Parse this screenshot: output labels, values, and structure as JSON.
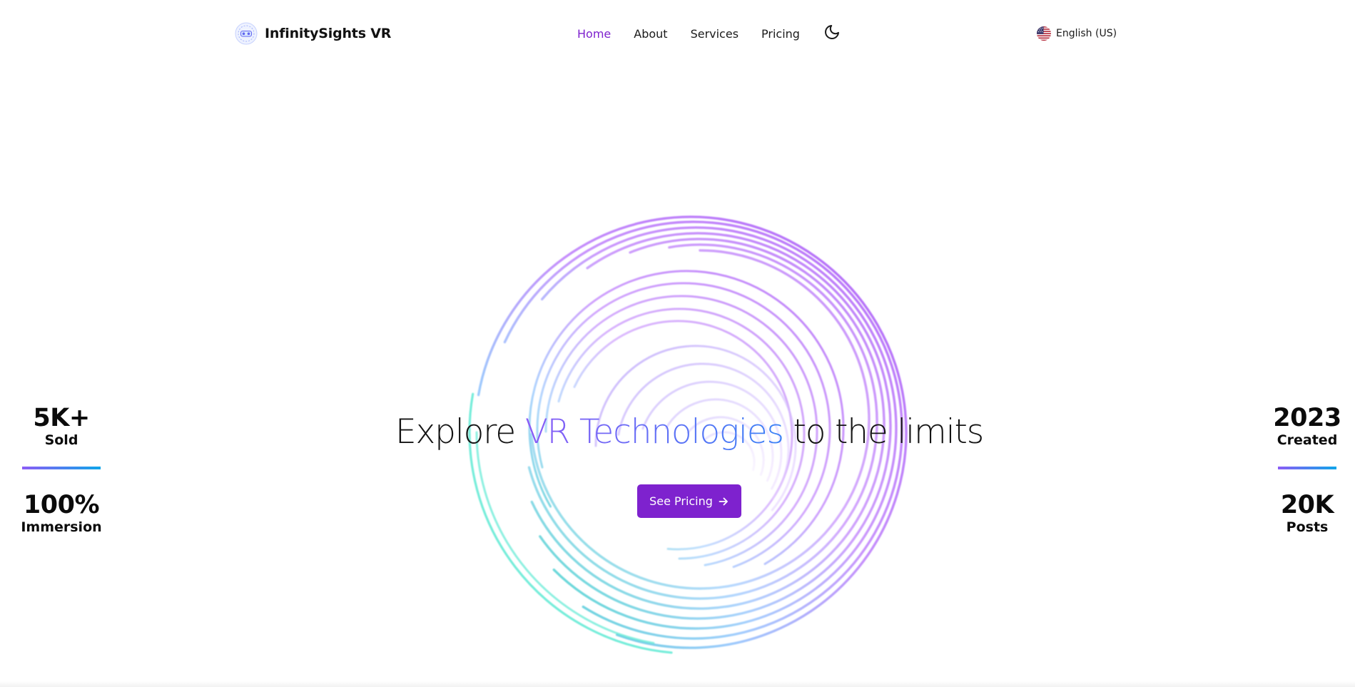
{
  "brand": {
    "name": "InfinitySights VR",
    "logo_icon": "vr-headset-logo-icon"
  },
  "nav": {
    "items": [
      {
        "label": "Home",
        "active": true
      },
      {
        "label": "About",
        "active": false
      },
      {
        "label": "Services",
        "active": false
      },
      {
        "label": "Pricing",
        "active": false
      }
    ],
    "theme_toggle_icon": "moon-icon",
    "active_color": "#7e22ce"
  },
  "language": {
    "label": "English (US)",
    "flag_icon": "us-flag-icon"
  },
  "hero": {
    "title_before": "Explore",
    "title_highlight": "VR Technologies",
    "title_after": "to the limits",
    "cta_label": "See Pricing",
    "cta_icon": "arrow-right-icon",
    "cta_color": "#7e22ce",
    "spiral_colors": [
      "#a855f7",
      "#c084fc",
      "#2dd4bf"
    ]
  },
  "stats": {
    "left": [
      {
        "value": "5K+",
        "label": "Sold"
      },
      {
        "value": "100%",
        "label": "Immersion"
      }
    ],
    "right": [
      {
        "value": "2023",
        "label": "Created"
      },
      {
        "value": "20K",
        "label": "Posts"
      }
    ],
    "divider_colors": [
      "#8b5cf6",
      "#0ea5e9"
    ]
  }
}
